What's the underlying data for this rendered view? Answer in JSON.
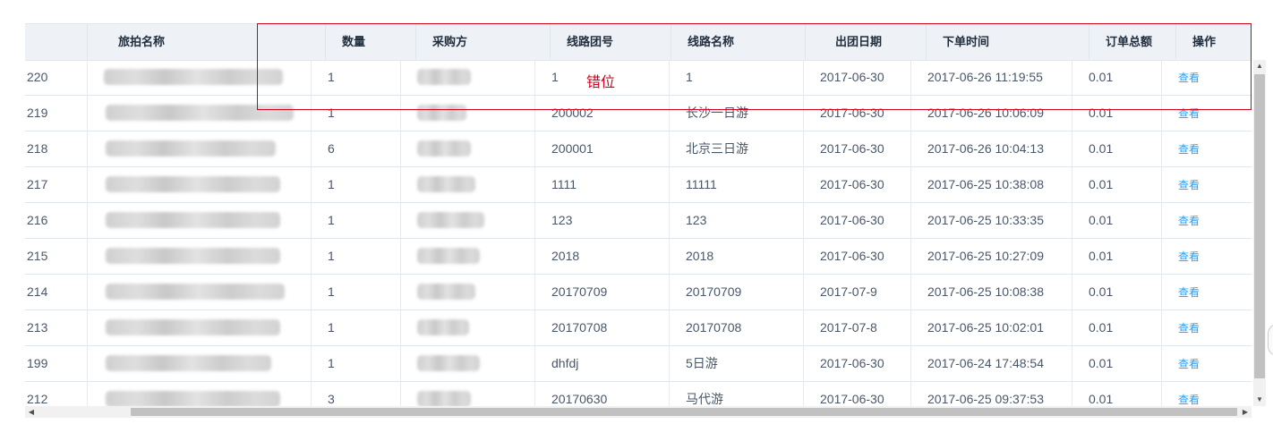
{
  "table": {
    "columns": [
      "旅拍名称",
      "数量",
      "采购方",
      "线路团号",
      "线路名称",
      "出团日期",
      "下单时间",
      "订单总额",
      "操作"
    ],
    "rows": [
      {
        "id": "220",
        "qty": "1",
        "tour_no": "1",
        "route": "1",
        "depart": "2017-06-30",
        "ordered": "2017-06-26 11:19:55",
        "total": "0.01",
        "action": "查看"
      },
      {
        "id": "219",
        "qty": "1",
        "tour_no": "200002",
        "route": "长沙一日游",
        "depart": "2017-06-30",
        "ordered": "2017-06-26 10:06:09",
        "total": "0.01",
        "action": "查看"
      },
      {
        "id": "218",
        "qty": "6",
        "tour_no": "200001",
        "route": "北京三日游",
        "depart": "2017-06-30",
        "ordered": "2017-06-26 10:04:13",
        "total": "0.01",
        "action": "查看"
      },
      {
        "id": "217",
        "qty": "1",
        "tour_no": "1111",
        "route": "11111",
        "depart": "2017-06-30",
        "ordered": "2017-06-25 10:38:08",
        "total": "0.01",
        "action": "查看"
      },
      {
        "id": "216",
        "qty": "1",
        "tour_no": "123",
        "route": "123",
        "depart": "2017-06-30",
        "ordered": "2017-06-25 10:33:35",
        "total": "0.01",
        "action": "查看"
      },
      {
        "id": "215",
        "qty": "1",
        "tour_no": "2018",
        "route": "2018",
        "depart": "2017-06-30",
        "ordered": "2017-06-25 10:27:09",
        "total": "0.01",
        "action": "查看"
      },
      {
        "id": "214",
        "qty": "1",
        "tour_no": "20170709",
        "route": "20170709",
        "depart": "2017-07-9",
        "ordered": "2017-06-25 10:08:38",
        "total": "0.01",
        "action": "查看"
      },
      {
        "id": "213",
        "qty": "1",
        "tour_no": "20170708",
        "route": "20170708",
        "depart": "2017-07-8",
        "ordered": "2017-06-25 10:02:01",
        "total": "0.01",
        "action": "查看"
      },
      {
        "id": "199",
        "qty": "1",
        "tour_no": "dhfdj",
        "route": "5日游",
        "depart": "2017-06-30",
        "ordered": "2017-06-24 17:48:54",
        "total": "0.01",
        "action": "查看"
      },
      {
        "id": "212",
        "qty": "3",
        "tour_no": "20170630",
        "route": "马代游",
        "depart": "2017-06-30",
        "ordered": "2017-06-25 09:37:53",
        "total": "0.01",
        "action": "查看"
      }
    ]
  },
  "annotation": {
    "label": "错位",
    "color": "#d0021b"
  },
  "colors": {
    "header_bg": "#eef1f6",
    "border": "#dfe6ec",
    "text": "#48576a",
    "link": "#20a0ff"
  },
  "icons": {
    "scroll_up": "triangle-up-icon",
    "scroll_down": "triangle-down-icon",
    "scroll_left": "triangle-left-icon",
    "scroll_right": "triangle-right-icon"
  }
}
